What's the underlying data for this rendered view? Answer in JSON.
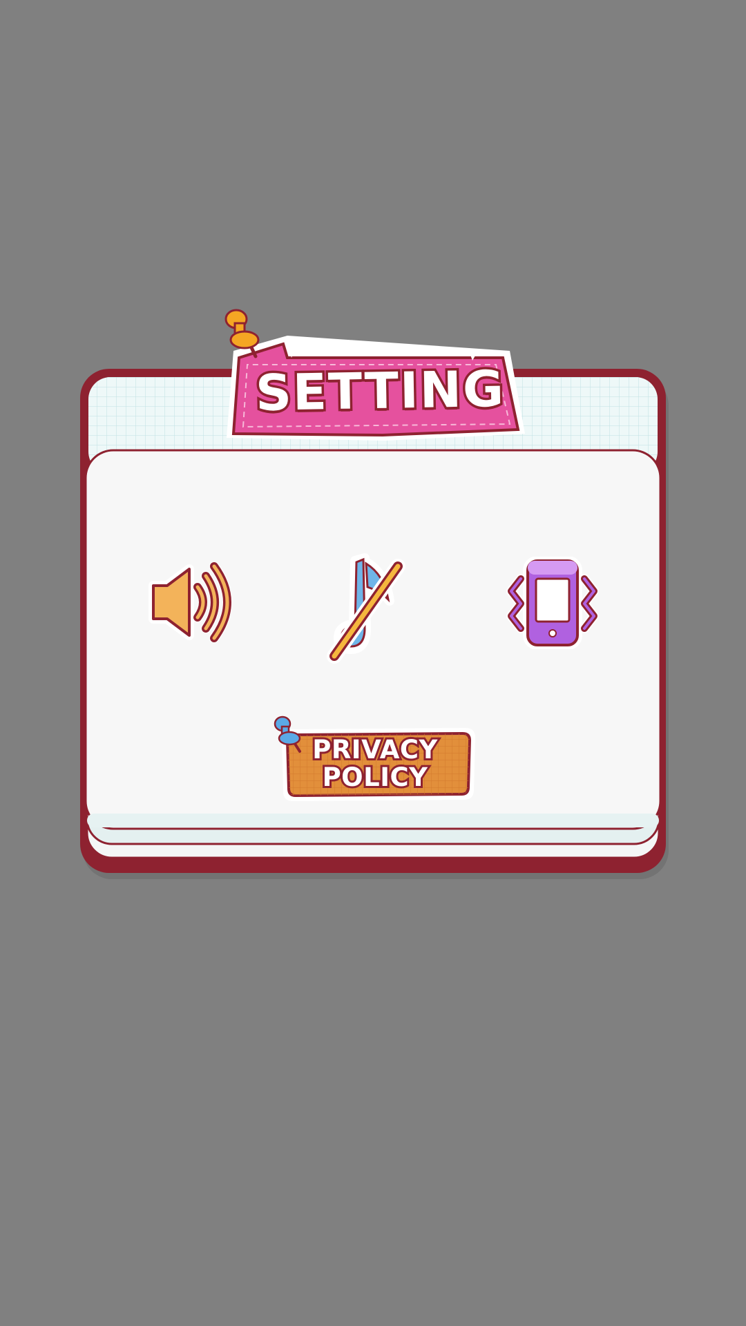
{
  "dialog": {
    "title": "SETTING"
  },
  "controls": [
    {
      "name": "sound",
      "icon": "speaker-on-icon",
      "state": "on"
    },
    {
      "name": "music",
      "icon": "music-off-icon",
      "state": "off"
    },
    {
      "name": "vibration",
      "icon": "phone-vibrate-icon",
      "state": "on"
    }
  ],
  "privacy_button": {
    "line1": "PRIVACY",
    "line2": "POLICY"
  },
  "colors": {
    "background": "#808080",
    "frame": "#8e2230",
    "title_tag": "#e5519e",
    "privacy_button": "#e28f3b",
    "sound_icon": "#f3b35a",
    "music_icon": "#6fb5e8",
    "vibrate_icon": "#b061e0"
  }
}
